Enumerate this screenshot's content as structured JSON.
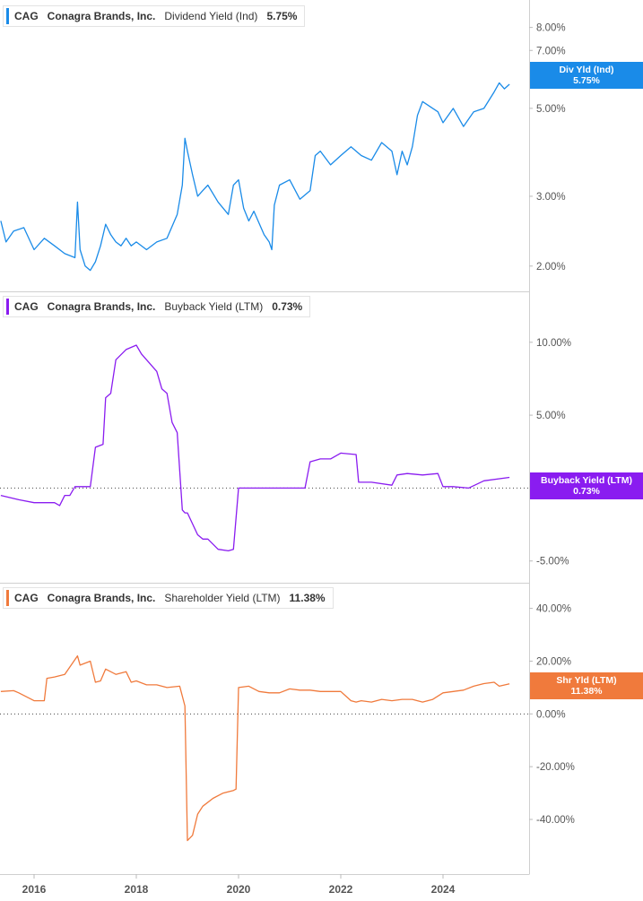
{
  "x_axis": {
    "ticks": [
      "2016",
      "2018",
      "2020",
      "2022",
      "2024"
    ]
  },
  "panels": [
    {
      "ticker": "CAG",
      "company": "Conagra Brands, Inc.",
      "metric": "Dividend Yield (Ind)",
      "value": "5.75%",
      "badge_label": "Div Yld (Ind)",
      "badge_value": "5.75%",
      "color": "#1a8be8"
    },
    {
      "ticker": "CAG",
      "company": "Conagra Brands, Inc.",
      "metric": "Buyback Yield (LTM)",
      "value": "0.73%",
      "badge_label": "Buyback Yield (LTM)",
      "badge_value": "0.73%",
      "color": "#8a1cf0"
    },
    {
      "ticker": "CAG",
      "company": "Conagra Brands, Inc.",
      "metric": "Shareholder Yield (LTM)",
      "value": "11.38%",
      "badge_label": "Shr Yld (LTM)",
      "badge_value": "11.38%",
      "color": "#f07a3c"
    }
  ],
  "chart_data": [
    {
      "type": "line",
      "scale": "log",
      "title": "Dividend Yield (Ind)",
      "ylim": [
        1.8,
        9.0
      ],
      "yticks": [
        {
          "v": 8,
          "label": "8.00%"
        },
        {
          "v": 7,
          "label": "7.00%"
        },
        {
          "v": 5,
          "label": "5.00%"
        },
        {
          "v": 3,
          "label": "3.00%"
        },
        {
          "v": 2,
          "label": "2.00%"
        }
      ],
      "series": [
        {
          "name": "Div Yld (Ind)",
          "x": [
            2015.35,
            2015.45,
            2015.6,
            2015.8,
            2016.0,
            2016.2,
            2016.4,
            2016.6,
            2016.8,
            2016.85,
            2016.9,
            2017.0,
            2017.1,
            2017.2,
            2017.3,
            2017.4,
            2017.5,
            2017.6,
            2017.7,
            2017.8,
            2017.9,
            2018.0,
            2018.2,
            2018.4,
            2018.6,
            2018.8,
            2018.9,
            2018.95,
            2019.0,
            2019.1,
            2019.2,
            2019.3,
            2019.4,
            2019.6,
            2019.8,
            2019.9,
            2020.0,
            2020.1,
            2020.2,
            2020.3,
            2020.5,
            2020.6,
            2020.65,
            2020.7,
            2020.8,
            2021.0,
            2021.2,
            2021.4,
            2021.5,
            2021.6,
            2021.8,
            2022.0,
            2022.2,
            2022.4,
            2022.6,
            2022.8,
            2023.0,
            2023.1,
            2023.2,
            2023.3,
            2023.4,
            2023.5,
            2023.6,
            2023.8,
            2023.9,
            2024.0,
            2024.2,
            2024.4,
            2024.6,
            2024.8,
            2025.0,
            2025.1,
            2025.2,
            2025.3
          ],
          "values": [
            2.6,
            2.3,
            2.45,
            2.5,
            2.2,
            2.35,
            2.25,
            2.15,
            2.1,
            2.9,
            2.2,
            2.0,
            1.95,
            2.05,
            2.25,
            2.55,
            2.4,
            2.3,
            2.25,
            2.35,
            2.25,
            2.3,
            2.2,
            2.3,
            2.35,
            2.7,
            3.2,
            4.2,
            3.9,
            3.4,
            3.0,
            3.1,
            3.2,
            2.9,
            2.7,
            3.2,
            3.3,
            2.8,
            2.6,
            2.75,
            2.4,
            2.3,
            2.2,
            2.85,
            3.2,
            3.3,
            2.95,
            3.1,
            3.8,
            3.9,
            3.6,
            3.8,
            4.0,
            3.8,
            3.7,
            4.1,
            3.9,
            3.4,
            3.9,
            3.6,
            4.0,
            4.8,
            5.2,
            5.0,
            4.9,
            4.6,
            5.0,
            4.5,
            4.9,
            5.0,
            5.5,
            5.8,
            5.6,
            5.75
          ]
        }
      ]
    },
    {
      "type": "line",
      "scale": "linear",
      "title": "Buyback Yield (LTM)",
      "ylim": [
        -6.0,
        13.0
      ],
      "yticks": [
        {
          "v": 10,
          "label": "10.00%"
        },
        {
          "v": 5,
          "label": "5.00%"
        },
        {
          "v": -5,
          "label": "-5.00%"
        }
      ],
      "zero_line": 0,
      "series": [
        {
          "name": "Buyback Yield (LTM)",
          "x": [
            2015.35,
            2015.7,
            2016.0,
            2016.4,
            2016.5,
            2016.6,
            2016.7,
            2016.8,
            2017.1,
            2017.2,
            2017.35,
            2017.4,
            2017.5,
            2017.6,
            2017.8,
            2018.0,
            2018.1,
            2018.2,
            2018.4,
            2018.5,
            2018.6,
            2018.7,
            2018.8,
            2018.9,
            2018.95,
            2019.0,
            2019.2,
            2019.3,
            2019.4,
            2019.6,
            2019.8,
            2019.9,
            2020.0,
            2021.0,
            2021.3,
            2021.4,
            2021.6,
            2021.8,
            2022.0,
            2022.3,
            2022.35,
            2022.6,
            2023.0,
            2023.1,
            2023.3,
            2023.6,
            2023.9,
            2024.0,
            2024.2,
            2024.5,
            2024.8,
            2025.3
          ],
          "values": [
            -0.5,
            -0.8,
            -1.0,
            -1.0,
            -1.2,
            -0.5,
            -0.5,
            0.1,
            0.1,
            2.8,
            3.0,
            6.2,
            6.5,
            8.8,
            9.5,
            9.8,
            9.2,
            8.8,
            8.0,
            6.8,
            6.5,
            4.5,
            3.8,
            -1.5,
            -1.7,
            -1.7,
            -3.2,
            -3.5,
            -3.5,
            -4.2,
            -4.3,
            -4.2,
            0.0,
            0.0,
            0.0,
            1.8,
            2.0,
            2.0,
            2.4,
            2.3,
            0.4,
            0.4,
            0.2,
            0.9,
            1.0,
            0.9,
            1.0,
            0.1,
            0.1,
            0.0,
            0.5,
            0.73
          ]
        }
      ]
    },
    {
      "type": "line",
      "scale": "linear",
      "title": "Shareholder Yield (LTM)",
      "ylim": [
        -58,
        47
      ],
      "yticks": [
        {
          "v": 40,
          "label": "40.00%"
        },
        {
          "v": 20,
          "label": "20.00%"
        },
        {
          "v": 0,
          "label": "0.00%"
        },
        {
          "v": -20,
          "label": "-20.00%"
        },
        {
          "v": -40,
          "label": "-40.00%"
        }
      ],
      "zero_line": 0,
      "series": [
        {
          "name": "Shr Yld (LTM)",
          "x": [
            2015.35,
            2015.6,
            2015.7,
            2016.0,
            2016.2,
            2016.25,
            2016.4,
            2016.6,
            2016.85,
            2016.9,
            2017.1,
            2017.2,
            2017.3,
            2017.4,
            2017.6,
            2017.8,
            2017.9,
            2018.0,
            2018.2,
            2018.4,
            2018.6,
            2018.85,
            2018.95,
            2019.0,
            2019.1,
            2019.2,
            2019.3,
            2019.5,
            2019.7,
            2019.9,
            2019.95,
            2020.0,
            2020.2,
            2020.4,
            2020.6,
            2020.8,
            2021.0,
            2021.2,
            2021.4,
            2021.6,
            2021.8,
            2022.0,
            2022.2,
            2022.3,
            2022.4,
            2022.6,
            2022.8,
            2023.0,
            2023.2,
            2023.4,
            2023.6,
            2023.8,
            2024.0,
            2024.2,
            2024.4,
            2024.6,
            2024.8,
            2025.0,
            2025.1,
            2025.3
          ],
          "values": [
            8.5,
            8.8,
            8.0,
            5.0,
            5.0,
            13.5,
            14.0,
            15.0,
            22.0,
            18.5,
            20.0,
            12.0,
            12.5,
            17.0,
            15.0,
            16.0,
            12.0,
            12.5,
            11.0,
            11.0,
            10.0,
            10.5,
            3.0,
            -48.0,
            -46.0,
            -38.0,
            -35.0,
            -32.0,
            -30.0,
            -29.0,
            -28.5,
            10.0,
            10.5,
            8.5,
            8.0,
            8.0,
            9.5,
            9.0,
            9.0,
            8.5,
            8.5,
            8.5,
            5.0,
            4.5,
            5.0,
            4.5,
            5.5,
            5.0,
            5.5,
            5.5,
            4.5,
            5.5,
            8.0,
            8.5,
            9.0,
            10.5,
            11.5,
            12.0,
            10.5,
            11.38
          ]
        }
      ]
    }
  ]
}
